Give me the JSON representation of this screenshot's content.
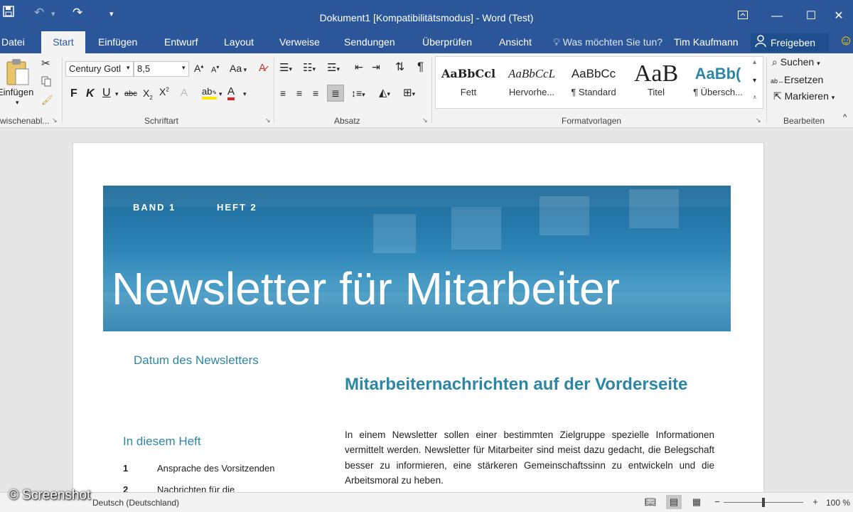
{
  "window": {
    "title": "Dokument1 [Kompatibilitätsmodus] - Word (Test)",
    "save_icon": "save-icon",
    "undo_icon": "undo-icon",
    "redo_icon": "redo-icon"
  },
  "tabs": {
    "items": [
      "Datei",
      "Start",
      "Einfügen",
      "Entwurf",
      "Layout",
      "Verweise",
      "Sendungen",
      "Überprüfen",
      "Ansicht"
    ],
    "active": "Start",
    "tell_me": "Was möchten Sie tun?",
    "user": "Tim Kaufmann",
    "share": "Freigeben"
  },
  "ribbon": {
    "clipboard": {
      "paste": "Einfügen",
      "label": "wischenabl..."
    },
    "font": {
      "family": "Century Gotl",
      "size": "8,5",
      "case_label": "Aa",
      "bold": "F",
      "italic": "K",
      "underline": "U",
      "strike": "abc",
      "label": "Schriftart"
    },
    "paragraph": {
      "label": "Absatz"
    },
    "styles": {
      "label": "Formatvorlagen",
      "items": [
        {
          "sample": "AaBbCcl",
          "name": "Fett"
        },
        {
          "sample": "AaBbCcL",
          "name": "Hervorhe..."
        },
        {
          "sample": "AaBbCc",
          "name": "¶ Standard"
        },
        {
          "sample": "AaB",
          "name": "Titel"
        },
        {
          "sample": "AaBb(",
          "name": "¶ Übersch..."
        }
      ]
    },
    "editing": {
      "label": "Bearbeiten",
      "find": "Suchen",
      "replace": "Ersetzen",
      "select": "Markieren"
    }
  },
  "document": {
    "band": "BAND 1",
    "heft": "HEFT 2",
    "headline": "Newsletter für Mitarbeiter",
    "date": "Datum des Newsletters",
    "article_title": "Mitarbeiternachrichten auf der Vorderseite",
    "toc_title": "In diesem Heft",
    "toc": [
      {
        "num": "1",
        "text": "Ansprache des Vorsitzenden"
      },
      {
        "num": "2",
        "text": "Nachrichten für die"
      }
    ],
    "body": "In einem Newsletter sollen einer bestimmten Zielgruppe spezielle Informationen vermittelt werden. Newsletter für Mitarbeiter sind meist dazu gedacht, die Belegschaft besser zu informieren, eine stärkeren Gemeinschaftssinn zu entwickeln und die Arbeitsmoral zu heben.",
    "accent_color": "#2e86a6"
  },
  "statusbar": {
    "language": "Deutsch (Deutschland)",
    "zoom": "100 %"
  },
  "watermark": "© Screenshot",
  "colors": {
    "brand": "#2b579a",
    "ribbon": "#f3f3f3"
  }
}
